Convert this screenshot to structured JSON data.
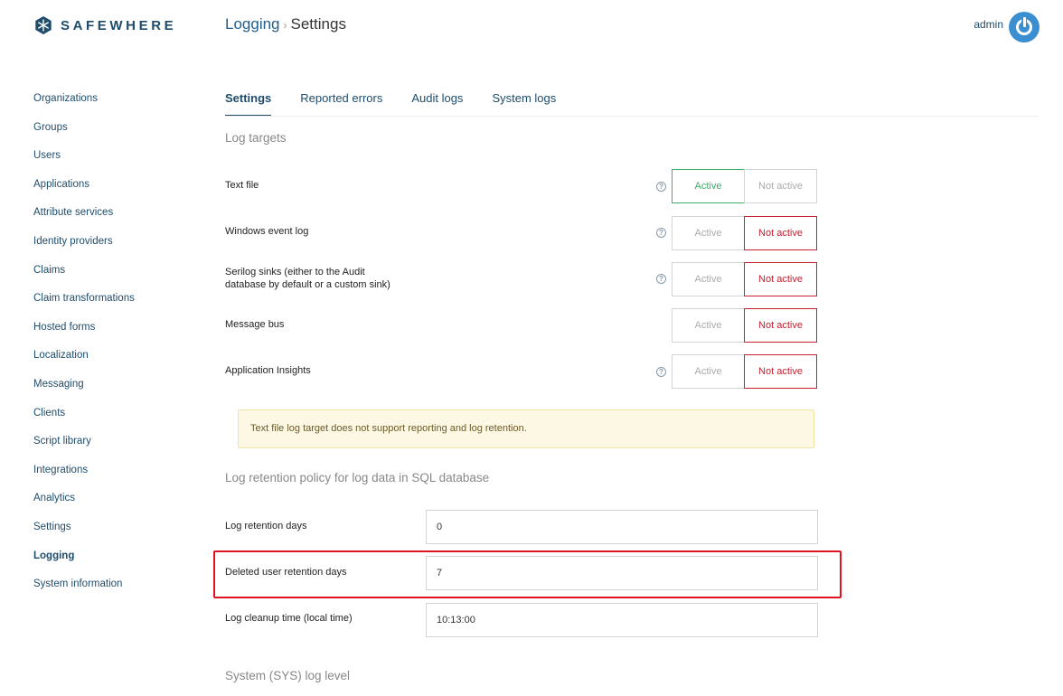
{
  "brand": {
    "name": "SAFEWHERE",
    "logo_icon": "snowflake-icon",
    "color": "#1f4c6b"
  },
  "breadcrumb": {
    "parent": "Logging",
    "separator": "›",
    "current": "Settings"
  },
  "user": {
    "name": "admin",
    "icon": "power-icon",
    "accent": "#3b8fd0"
  },
  "sidebar": {
    "items": [
      {
        "label": "Organizations"
      },
      {
        "label": "Groups"
      },
      {
        "label": "Users"
      },
      {
        "label": "Applications"
      },
      {
        "label": "Attribute services"
      },
      {
        "label": "Identity providers"
      },
      {
        "label": "Claims"
      },
      {
        "label": "Claim transformations"
      },
      {
        "label": "Hosted forms"
      },
      {
        "label": "Localization"
      },
      {
        "label": "Messaging"
      },
      {
        "label": "Clients"
      },
      {
        "label": "Script library"
      },
      {
        "label": "Integrations"
      },
      {
        "label": "Analytics"
      },
      {
        "label": "Settings"
      },
      {
        "label": "Logging",
        "active": true
      },
      {
        "label": "System information"
      }
    ]
  },
  "tabs": [
    {
      "label": "Settings",
      "active": true
    },
    {
      "label": "Reported errors"
    },
    {
      "label": "Audit logs"
    },
    {
      "label": "System logs"
    }
  ],
  "log_targets": {
    "title": "Log targets",
    "active_label": "Active",
    "inactive_label": "Not active",
    "colors": {
      "active": "#3fae6b",
      "inactive": "#c6202e"
    },
    "rows": [
      {
        "label": "Text file",
        "help": true,
        "state": "active"
      },
      {
        "label": "Windows event log",
        "help": true,
        "state": "inactive"
      },
      {
        "label_line1": "Serilog sinks (either to the Audit",
        "label_line2": "database by default or a custom sink)",
        "help": true,
        "state": "inactive"
      },
      {
        "label": "Message bus",
        "help": false,
        "state": "inactive"
      },
      {
        "label": "Application Insights",
        "help": true,
        "state": "inactive"
      }
    ],
    "notice": "Text file log target does not support reporting and log retention."
  },
  "retention": {
    "title": "Log retention policy for log data in SQL database",
    "fields": [
      {
        "label": "Log retention days",
        "value": "0"
      },
      {
        "label": "Deleted user retention days",
        "value": "7"
      },
      {
        "label": "Log cleanup time (local time)",
        "value": "10:13:00"
      }
    ]
  },
  "sys_log": {
    "title": "System (SYS) log level"
  },
  "help_icon_glyph": "?"
}
